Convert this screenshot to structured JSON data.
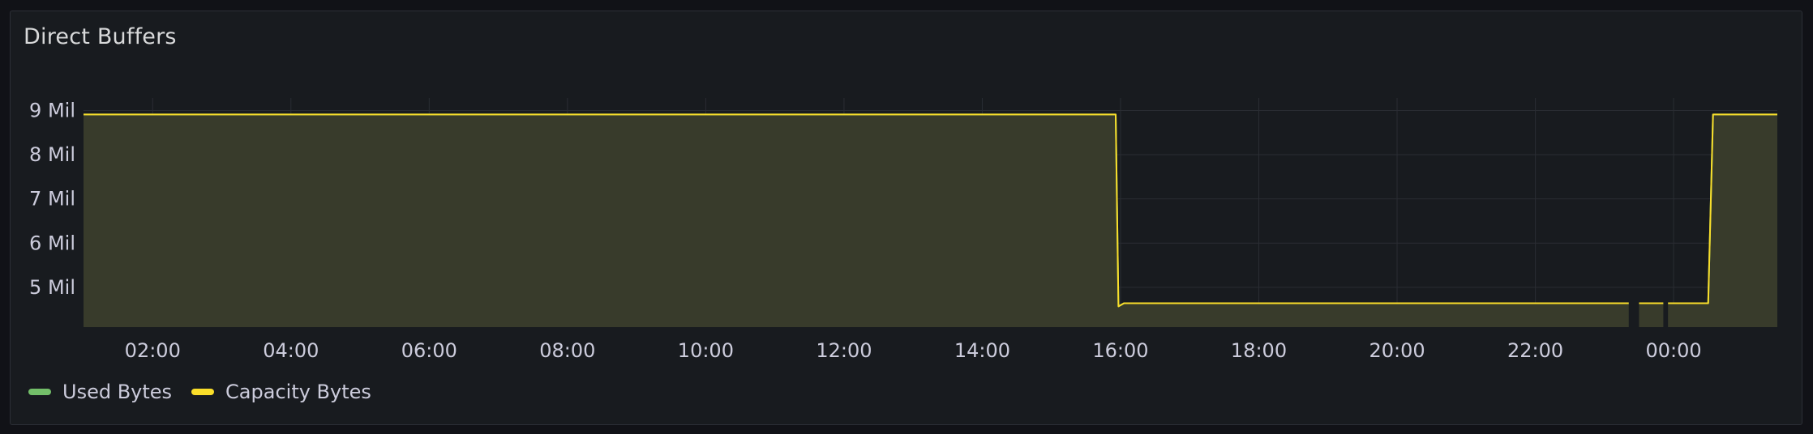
{
  "panel": {
    "title": "Direct Buffers"
  },
  "legend": [
    {
      "label": "Used Bytes",
      "color": "#73bf69"
    },
    {
      "label": "Capacity Bytes",
      "color": "#fade2a"
    }
  ],
  "colors": {
    "grid": "#2a2d33",
    "area": "#393c2b",
    "axis_text": "#ccccdc"
  },
  "chart_data": {
    "type": "area",
    "x_unit": "hours (time of day; values > 24 are after midnight)",
    "xlim": [
      1.0,
      25.5
    ],
    "x_ticks": [
      2,
      4,
      6,
      8,
      10,
      12,
      14,
      16,
      18,
      20,
      22,
      24
    ],
    "x_tick_labels": [
      "02:00",
      "04:00",
      "06:00",
      "08:00",
      "10:00",
      "12:00",
      "14:00",
      "16:00",
      "18:00",
      "20:00",
      "22:00",
      "00:00"
    ],
    "ylim": [
      4.1,
      9.1
    ],
    "y_ticks": [
      5,
      6,
      7,
      8,
      9
    ],
    "y_tick_labels": [
      "5 Mil",
      "6 Mil",
      "7 Mil",
      "8 Mil",
      "9 Mil"
    ],
    "series": [
      {
        "name": "Capacity Bytes",
        "color": "#fade2a",
        "y_unit": "millions",
        "segments": [
          {
            "x": [
              1.0,
              15.93,
              15.97,
              16.05,
              23.35
            ],
            "y": [
              8.91,
              8.91,
              4.57,
              4.64,
              4.64
            ]
          },
          {
            "x": [
              23.5,
              23.85
            ],
            "y": [
              4.64,
              4.64
            ]
          },
          {
            "x": [
              23.92,
              24.5,
              24.57,
              25.5
            ],
            "y": [
              4.64,
              4.64,
              8.91,
              8.91
            ]
          }
        ]
      },
      {
        "name": "Used Bytes",
        "color": "#73bf69",
        "y_unit": "millions",
        "segments": [
          {
            "x": [
              1.0,
              15.93,
              15.97,
              16.05,
              23.35
            ],
            "y": [
              8.91,
              8.91,
              4.57,
              4.64,
              4.64
            ]
          },
          {
            "x": [
              23.5,
              23.85
            ],
            "y": [
              4.64,
              4.64
            ]
          },
          {
            "x": [
              23.92,
              24.5,
              24.57,
              25.5
            ],
            "y": [
              4.64,
              4.64,
              8.91,
              8.91
            ]
          }
        ]
      }
    ]
  }
}
